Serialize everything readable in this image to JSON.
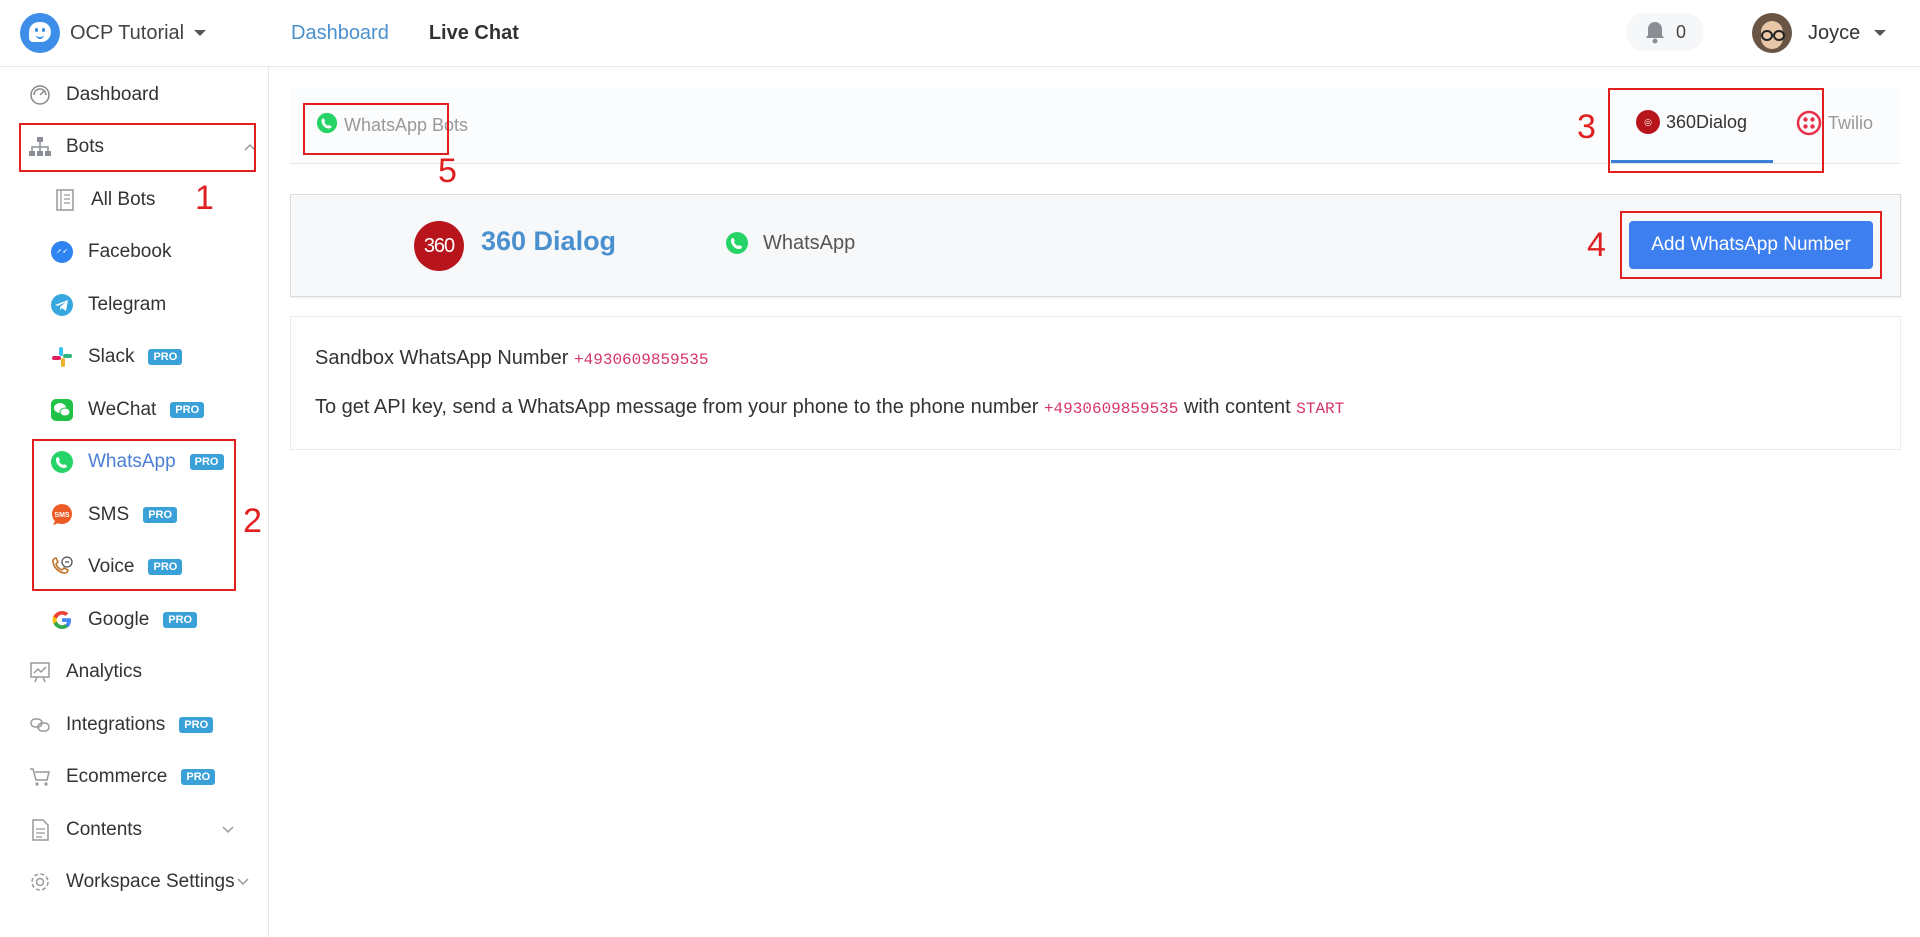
{
  "app": {
    "workspace_name": "OCP Tutorial"
  },
  "topnav": {
    "dashboard": "Dashboard",
    "live_chat": "Live Chat"
  },
  "notifications": {
    "count": "0"
  },
  "user": {
    "name": "Joyce"
  },
  "sidebar": {
    "dashboard": "Dashboard",
    "bots": "Bots",
    "all_bots": "All Bots",
    "facebook": "Facebook",
    "telegram": "Telegram",
    "slack": "Slack",
    "wechat": "WeChat",
    "whatsapp": "WhatsApp",
    "sms": "SMS",
    "voice": "Voice",
    "google": "Google",
    "analytics": "Analytics",
    "integrations": "Integrations",
    "ecommerce": "Ecommerce",
    "contents": "Contents",
    "workspace_settings": "Workspace Settings",
    "pro_badge": "PRO",
    "sms_icon_text": "SMS"
  },
  "annotations": {
    "a1": "1",
    "a2": "2",
    "a3": "3",
    "a4": "4",
    "a5": "5"
  },
  "main": {
    "whatsapp_bots_tab": "WhatsApp Bots",
    "provider_tabs": {
      "dialog360": "360Dialog",
      "twilio": "Twilio"
    },
    "provider_card": {
      "logo_text": "360",
      "title": "360 Dialog",
      "channel": "WhatsApp",
      "add_button": "Add WhatsApp Number"
    },
    "info": {
      "sandbox_label": "Sandbox WhatsApp Number",
      "sandbox_number": "+4930609859535",
      "api_prefix": "To get API key, send a WhatsApp message from your phone to the phone number",
      "api_number": "+4930609859535",
      "api_mid": "with content",
      "api_keyword": "START"
    }
  },
  "colors": {
    "accent": "#4a90cf",
    "button": "#3e7ff0",
    "annotation": "#e02020",
    "pro_badge": "#3aa0d8",
    "whatsapp_green": "#25d366"
  }
}
